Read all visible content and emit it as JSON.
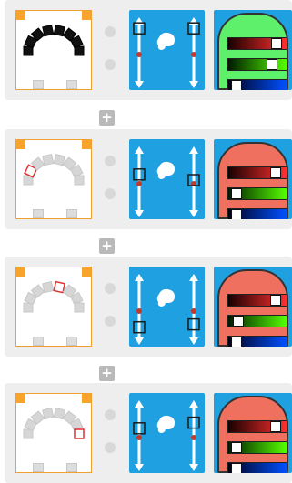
{
  "add_button_label": "+",
  "colors": {
    "panel_blue": "#1fa0e0",
    "arc_orange": "#f7a32c",
    "selected_led_outline": "#e03030"
  },
  "cards": [
    {
      "arc": {
        "active_led": null,
        "all_black": true
      },
      "servo": {
        "left_level": 0.9,
        "right_level": 0.9
      },
      "color": {
        "fill": "#5ef06a",
        "red": 0.9,
        "green": 0.8,
        "blue": 0.05
      }
    },
    {
      "arc": {
        "active_led": 1,
        "all_black": false
      },
      "servo": {
        "left_level": 0.6,
        "right_level": 0.5
      },
      "color": {
        "fill": "#f07060",
        "red": 0.88,
        "green": 0.05,
        "blue": 0.05
      }
    },
    {
      "arc": {
        "active_led": 4,
        "all_black": false
      },
      "servo": {
        "left_level": 0.15,
        "right_level": 0.2
      },
      "color": {
        "fill": "#f07060",
        "red": 0.88,
        "green": 0.1,
        "blue": 0.05
      }
    },
    {
      "arc": {
        "active_led": 7,
        "all_black": false
      },
      "servo": {
        "left_level": 0.6,
        "right_level": 0.7
      },
      "color": {
        "fill": "#f07060",
        "red": 0.88,
        "green": 0.05,
        "blue": 0.05
      }
    }
  ]
}
